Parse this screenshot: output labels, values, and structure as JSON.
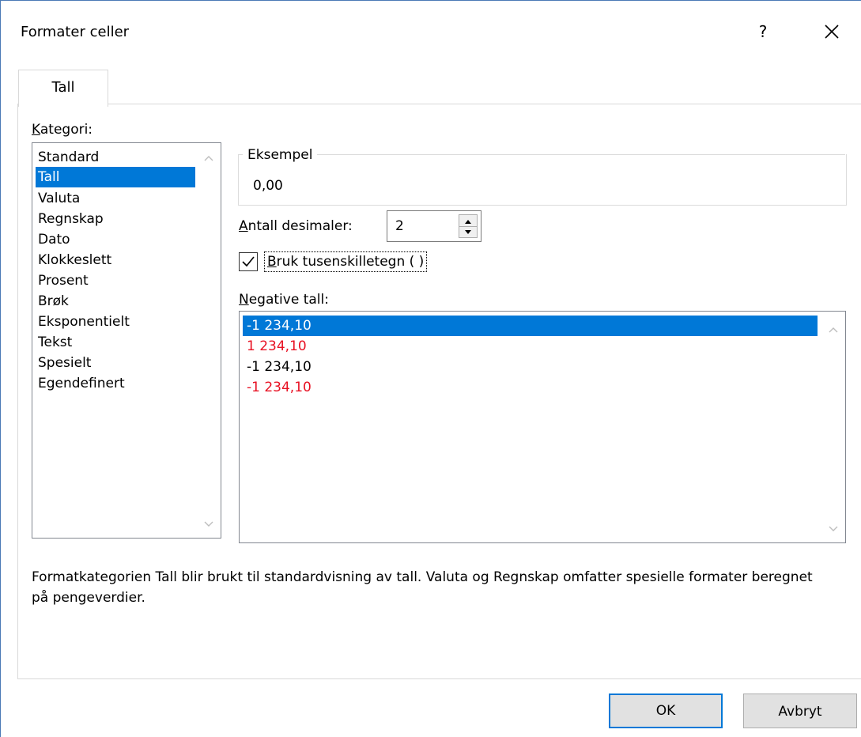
{
  "window": {
    "title": "Formater celler",
    "help_label": "?",
    "close_icon": "close-icon"
  },
  "tabs": [
    {
      "label": "Tall",
      "active": true
    }
  ],
  "category": {
    "label_first": "K",
    "label_rest": "ategori:",
    "items": [
      {
        "label": "Standard"
      },
      {
        "label": "Tall",
        "selected": true
      },
      {
        "label": "Valuta"
      },
      {
        "label": "Regnskap"
      },
      {
        "label": "Dato"
      },
      {
        "label": "Klokkeslett"
      },
      {
        "label": "Prosent"
      },
      {
        "label": "Brøk"
      },
      {
        "label": "Eksponentielt"
      },
      {
        "label": "Tekst"
      },
      {
        "label": "Spesielt"
      },
      {
        "label": "Egendefinert"
      }
    ]
  },
  "sample": {
    "title": "Eksempel",
    "value": "0,00"
  },
  "decimals": {
    "label_first": "A",
    "label_rest": "ntall desimaler:",
    "value": "2"
  },
  "thousands": {
    "checked": true,
    "label_first": "B",
    "label_rest": "ruk tusenskilletegn ( )"
  },
  "negative": {
    "label_first": "N",
    "label_rest": "egative tall:",
    "items": [
      {
        "label": "-1 234,10",
        "color": "#000000",
        "selected": true
      },
      {
        "label": "1 234,10",
        "color": "#e81123"
      },
      {
        "label": "-1 234,10",
        "color": "#000000"
      },
      {
        "label": "-1 234,10",
        "color": "#e81123"
      }
    ]
  },
  "description": "Formatkategorien Tall blir brukt til standardvisning av tall. Valuta og Regnskap omfatter spesielle formater beregnet på pengeverdier.",
  "buttons": {
    "ok": "OK",
    "cancel": "Avbryt"
  },
  "colors": {
    "accent": "#0078d7",
    "negative_red": "#e81123"
  }
}
